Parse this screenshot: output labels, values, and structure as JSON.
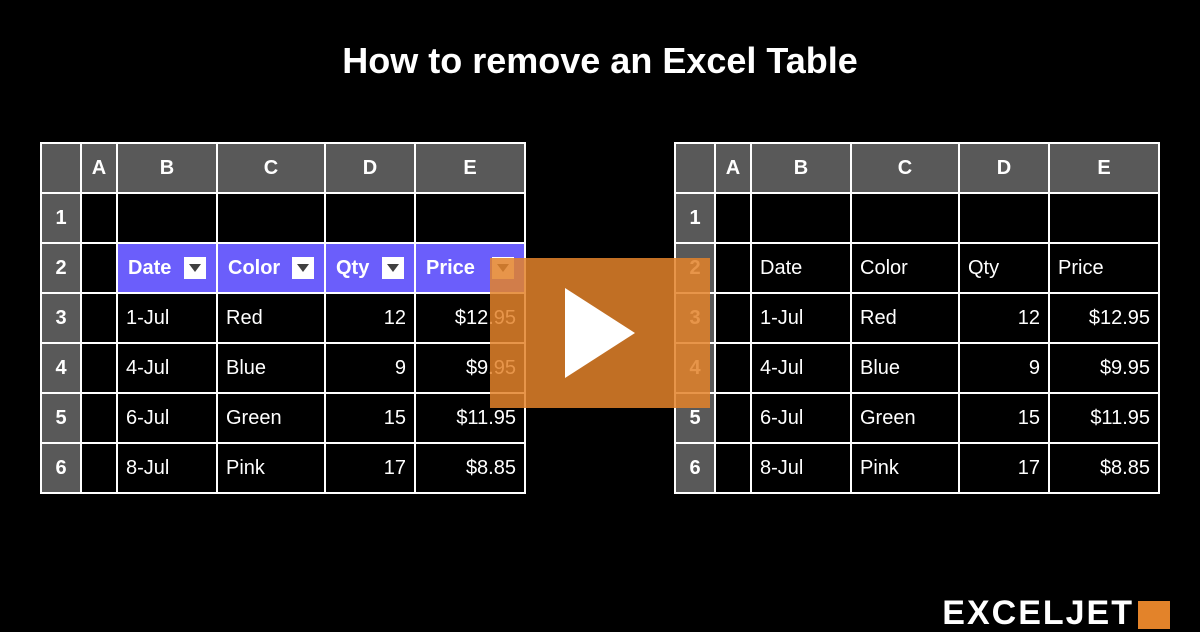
{
  "title": "How to remove an Excel Table",
  "columns": [
    "A",
    "B",
    "C",
    "D",
    "E"
  ],
  "row_numbers": [
    "1",
    "2",
    "3",
    "4",
    "5",
    "6"
  ],
  "table_headers": {
    "date": "Date",
    "color": "Color",
    "qty": "Qty",
    "price": "Price"
  },
  "rows": [
    {
      "date": "1-Jul",
      "color": "Red",
      "qty": "12",
      "price": "$12.95"
    },
    {
      "date": "4-Jul",
      "color": "Blue",
      "qty": "9",
      "price": "$9.95"
    },
    {
      "date": "6-Jul",
      "color": "Green",
      "qty": "15",
      "price": "$11.95"
    },
    {
      "date": "8-Jul",
      "color": "Pink",
      "qty": "17",
      "price": "$8.85"
    }
  ],
  "brand": "EXCELJET"
}
